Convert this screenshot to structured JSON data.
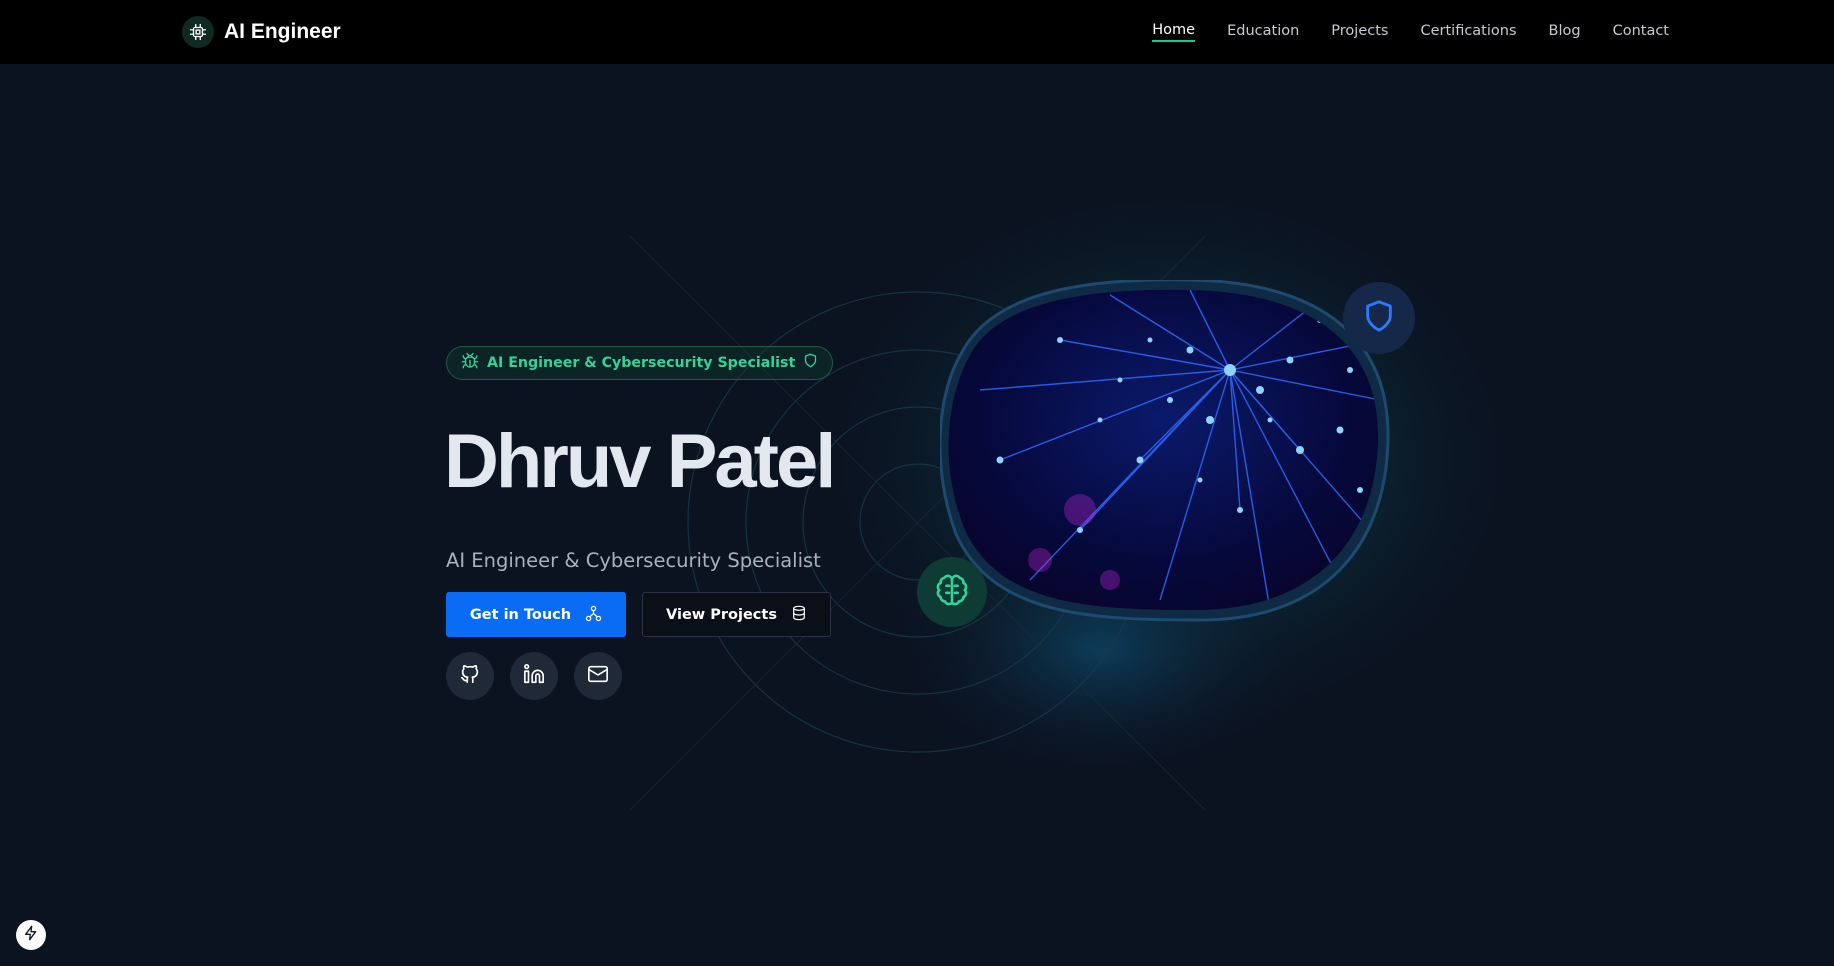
{
  "brand": {
    "title": "AI Engineer",
    "logo_icon": "cpu-icon"
  },
  "nav": {
    "items": [
      {
        "label": "Home",
        "active": true
      },
      {
        "label": "Education",
        "active": false
      },
      {
        "label": "Projects",
        "active": false
      },
      {
        "label": "Certifications",
        "active": false
      },
      {
        "label": "Blog",
        "active": false
      },
      {
        "label": "Contact",
        "active": false
      }
    ]
  },
  "hero": {
    "tag": {
      "text": "AI Engineer & Cybersecurity Specialist",
      "leading_icon": "bug-icon",
      "trailing_icon": "shield-icon"
    },
    "name": "Dhruv Patel",
    "subtitle": "AI Engineer & Cybersecurity Specialist",
    "primary_button": {
      "label": "Get in Touch",
      "icon": "network-icon"
    },
    "secondary_button": {
      "label": "View Projects",
      "icon": "database-icon"
    },
    "socials": [
      {
        "name": "github",
        "icon": "github-icon"
      },
      {
        "name": "linkedin",
        "icon": "linkedin-icon"
      },
      {
        "name": "email",
        "icon": "mail-icon"
      }
    ],
    "visual": {
      "image_icon": "neural-network-image",
      "floating_icons": [
        "shield-icon",
        "brain-icon"
      ]
    }
  },
  "colors": {
    "background": "#0b1220",
    "navbar": "#000000",
    "accent_green": "#22c58b",
    "accent_blue": "#0a6cf5",
    "text_primary": "#e3e8f0",
    "text_muted": "#a9b1bf"
  },
  "corner_badge": {
    "icon": "bolt-icon"
  }
}
